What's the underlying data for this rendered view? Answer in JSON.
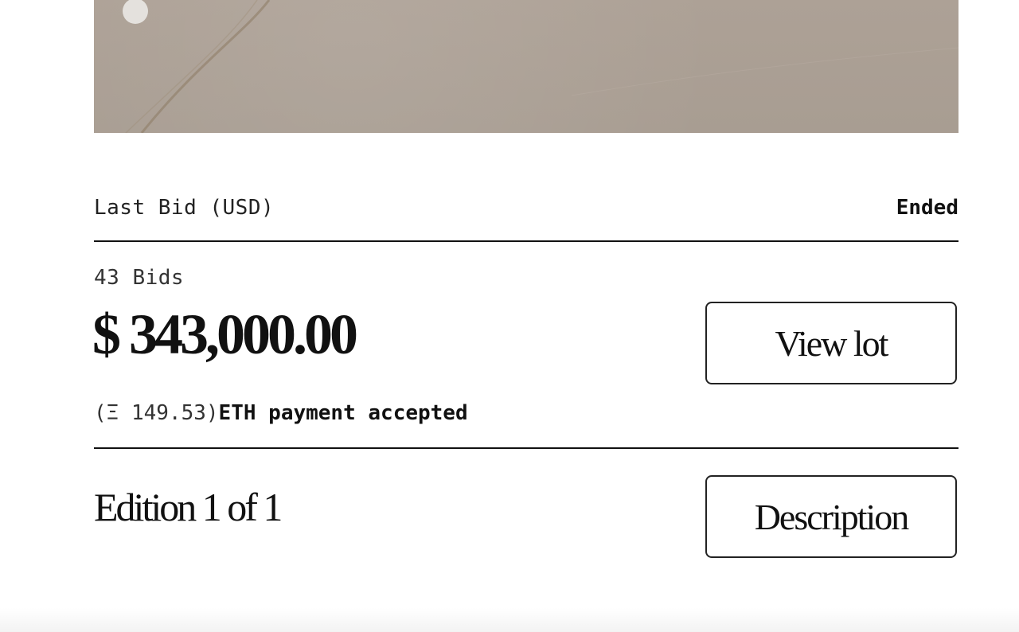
{
  "auction": {
    "last_bid_label": "Last Bid (USD)",
    "status": "Ended",
    "bid_count": "43 Bids",
    "price": "$ 343,000.00",
    "eth_amount": "(Ξ 149.53)",
    "eth_note": "ETH payment accepted"
  },
  "buttons": {
    "view_lot": "View lot",
    "description": "Description"
  },
  "edition": {
    "label": "Edition 1 of 1"
  }
}
